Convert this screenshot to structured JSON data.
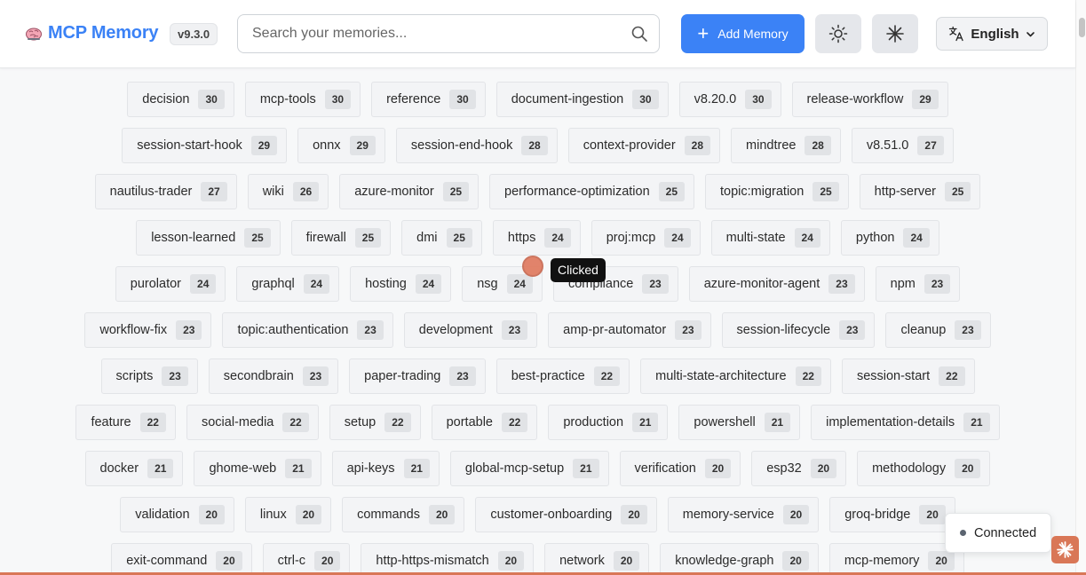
{
  "header": {
    "app_title": "MCP Memory",
    "version": "v9.3.0",
    "search_placeholder": "Search your memories...",
    "add_button_label": "Add Memory",
    "language_label": "English"
  },
  "colors": {
    "accent": "#3b82f6",
    "claude": "#d97757",
    "page_bg": "#f7f8f9"
  },
  "icons": {
    "logo": "brain-icon",
    "search": "search-icon",
    "add": "plus-icon",
    "theme": "sun-icon",
    "other": "asterisk-icon",
    "language": "translate-icon",
    "dropdown": "chevron-down-icon"
  },
  "tag_rows": [
    [
      [
        "decision",
        "30"
      ],
      [
        "mcp-tools",
        "30"
      ],
      [
        "reference",
        "30"
      ],
      [
        "document-ingestion",
        "30"
      ],
      [
        "v8.20.0",
        "30"
      ],
      [
        "release-workflow",
        "29"
      ]
    ],
    [
      [
        "session-start-hook",
        "29"
      ],
      [
        "onnx",
        "29"
      ],
      [
        "session-end-hook",
        "28"
      ],
      [
        "context-provider",
        "28"
      ],
      [
        "mindtree",
        "28"
      ],
      [
        "v8.51.0",
        "27"
      ]
    ],
    [
      [
        "nautilus-trader",
        "27"
      ],
      [
        "wiki",
        "26"
      ],
      [
        "azure-monitor",
        "25"
      ],
      [
        "performance-optimization",
        "25"
      ],
      [
        "topic:migration",
        "25"
      ],
      [
        "http-server",
        "25"
      ]
    ],
    [
      [
        "lesson-learned",
        "25"
      ],
      [
        "firewall",
        "25"
      ],
      [
        "dmi",
        "25"
      ],
      [
        "https",
        "24"
      ],
      [
        "proj:mcp",
        "24"
      ],
      [
        "multi-state",
        "24"
      ],
      [
        "python",
        "24"
      ]
    ],
    [
      [
        "purolator",
        "24"
      ],
      [
        "graphql",
        "24"
      ],
      [
        "hosting",
        "24"
      ],
      [
        "nsg",
        "24"
      ],
      [
        "compliance",
        "23"
      ],
      [
        "azure-monitor-agent",
        "23"
      ],
      [
        "npm",
        "23"
      ]
    ],
    [
      [
        "workflow-fix",
        "23"
      ],
      [
        "topic:authentication",
        "23"
      ],
      [
        "development",
        "23"
      ],
      [
        "amp-pr-automator",
        "23"
      ],
      [
        "session-lifecycle",
        "23"
      ],
      [
        "cleanup",
        "23"
      ]
    ],
    [
      [
        "scripts",
        "23"
      ],
      [
        "secondbrain",
        "23"
      ],
      [
        "paper-trading",
        "23"
      ],
      [
        "best-practice",
        "22"
      ],
      [
        "multi-state-architecture",
        "22"
      ],
      [
        "session-start",
        "22"
      ]
    ],
    [
      [
        "feature",
        "22"
      ],
      [
        "social-media",
        "22"
      ],
      [
        "setup",
        "22"
      ],
      [
        "portable",
        "22"
      ],
      [
        "production",
        "21"
      ],
      [
        "powershell",
        "21"
      ],
      [
        "implementation-details",
        "21"
      ]
    ],
    [
      [
        "docker",
        "21"
      ],
      [
        "ghome-web",
        "21"
      ],
      [
        "api-keys",
        "21"
      ],
      [
        "global-mcp-setup",
        "21"
      ],
      [
        "verification",
        "20"
      ],
      [
        "esp32",
        "20"
      ],
      [
        "methodology",
        "20"
      ]
    ],
    [
      [
        "validation",
        "20"
      ],
      [
        "linux",
        "20"
      ],
      [
        "commands",
        "20"
      ],
      [
        "customer-onboarding",
        "20"
      ],
      [
        "memory-service",
        "20"
      ],
      [
        "groq-bridge",
        "20"
      ]
    ],
    [
      [
        "exit-command",
        "20"
      ],
      [
        "ctrl-c",
        "20"
      ],
      [
        "http-https-mismatch",
        "20"
      ],
      [
        "network",
        "20"
      ],
      [
        "knowledge-graph",
        "20"
      ],
      [
        "mcp-memory",
        "20"
      ]
    ]
  ],
  "tooltip": "Clicked",
  "status": "Connected"
}
